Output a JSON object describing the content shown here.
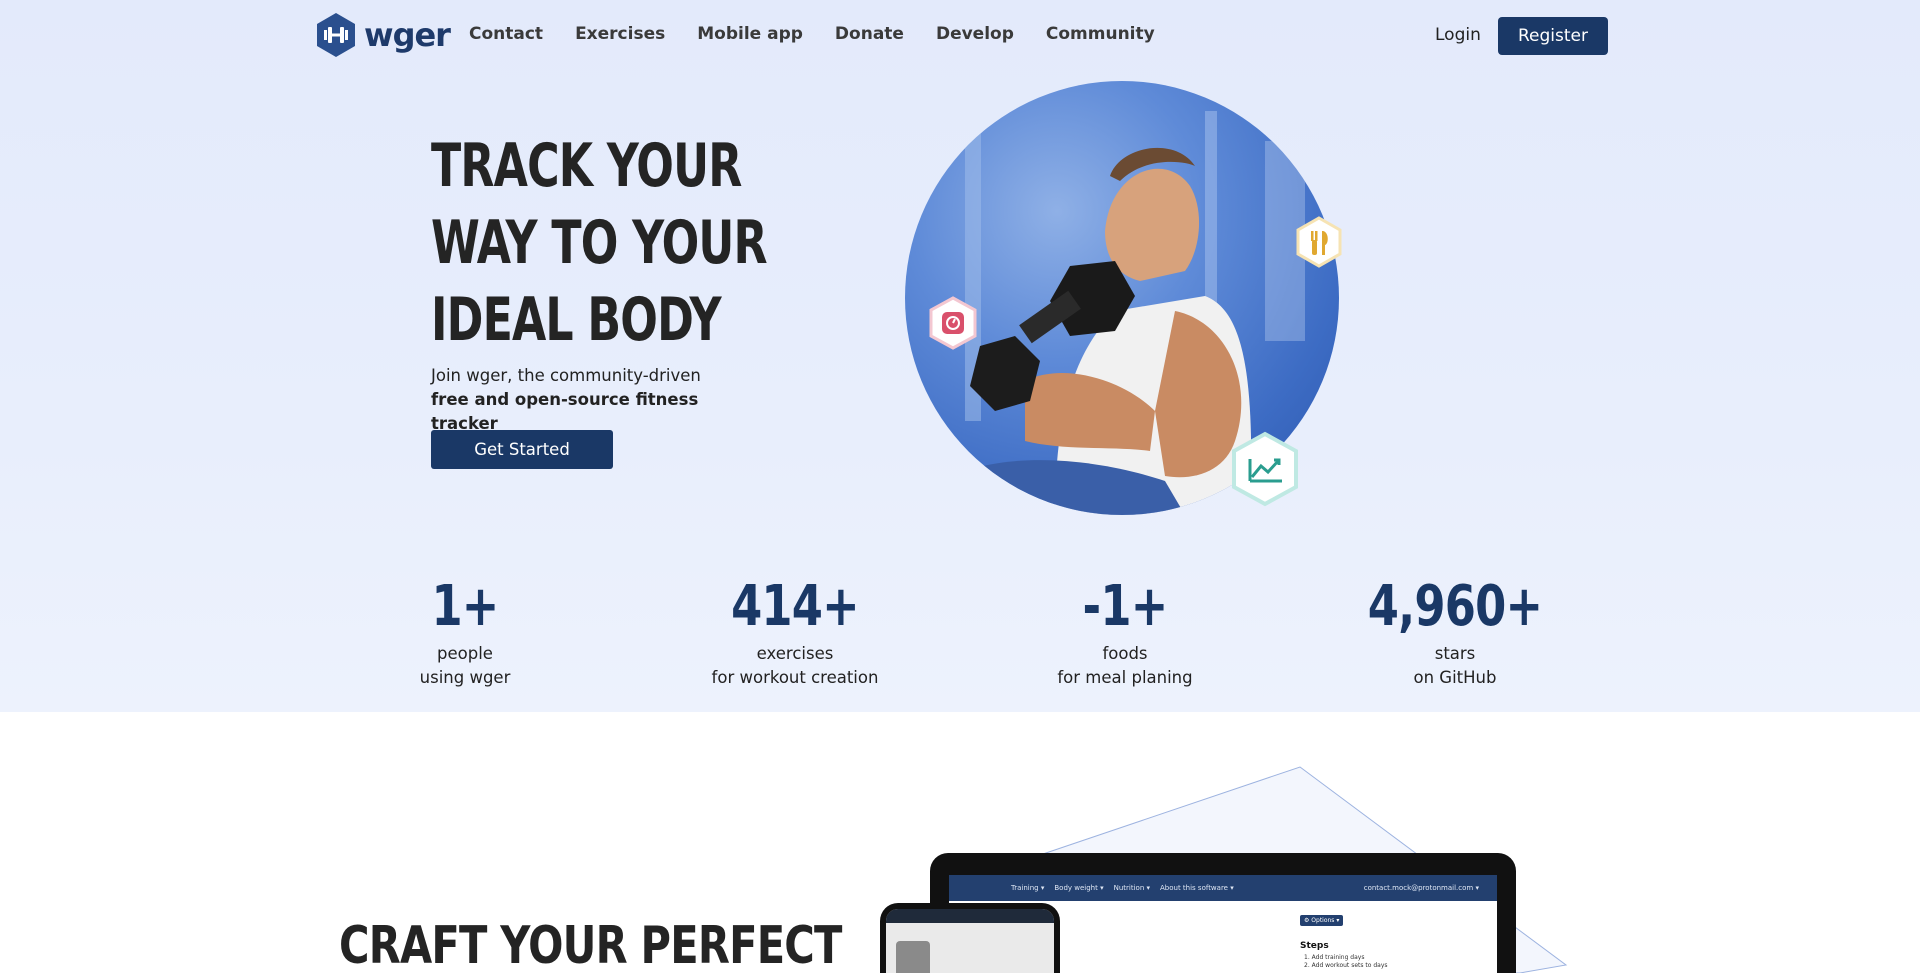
{
  "brand": {
    "name": "wger"
  },
  "nav": {
    "links": [
      "Contact",
      "Exercises",
      "Mobile app",
      "Donate",
      "Develop",
      "Community"
    ],
    "login": "Login",
    "register": "Register"
  },
  "hero": {
    "headline": [
      "Track your",
      "way to your",
      "ideal body"
    ],
    "subtext_plain": "Join wger, the community-driven ",
    "subtext_bold": "free and open-source fitness tracker",
    "cta": "Get Started",
    "badges": [
      "timer-icon",
      "cutlery-icon",
      "chart-trend-icon"
    ]
  },
  "stats": [
    {
      "value": "1+",
      "line1": "people",
      "line2": "using wger"
    },
    {
      "value": "414+",
      "line1": "exercises",
      "line2": "for workout creation"
    },
    {
      "value": "-1+",
      "line1": "foods",
      "line2": "for meal planing"
    },
    {
      "value": "4,960+",
      "line1": "stars",
      "line2": "on GitHub"
    }
  ],
  "section2": {
    "title": "Craft your perfect",
    "laptop_menu": [
      "Training ▾",
      "Body weight ▾",
      "Nutrition ▾",
      "About this software ▾"
    ],
    "laptop_user": "contact.mock@protonmail.com ▾",
    "laptop_options": "⚙ Options ▾",
    "laptop_steps_title": "Steps",
    "laptop_steps": [
      "1. Add training days",
      "2. Add workout sets to days"
    ]
  },
  "colors": {
    "primary": "#1a3866",
    "hero_bg": "#e3eafb",
    "badge_timer": "#d9506b",
    "badge_food": "#e0a830",
    "badge_chart": "#2a9d8f"
  }
}
